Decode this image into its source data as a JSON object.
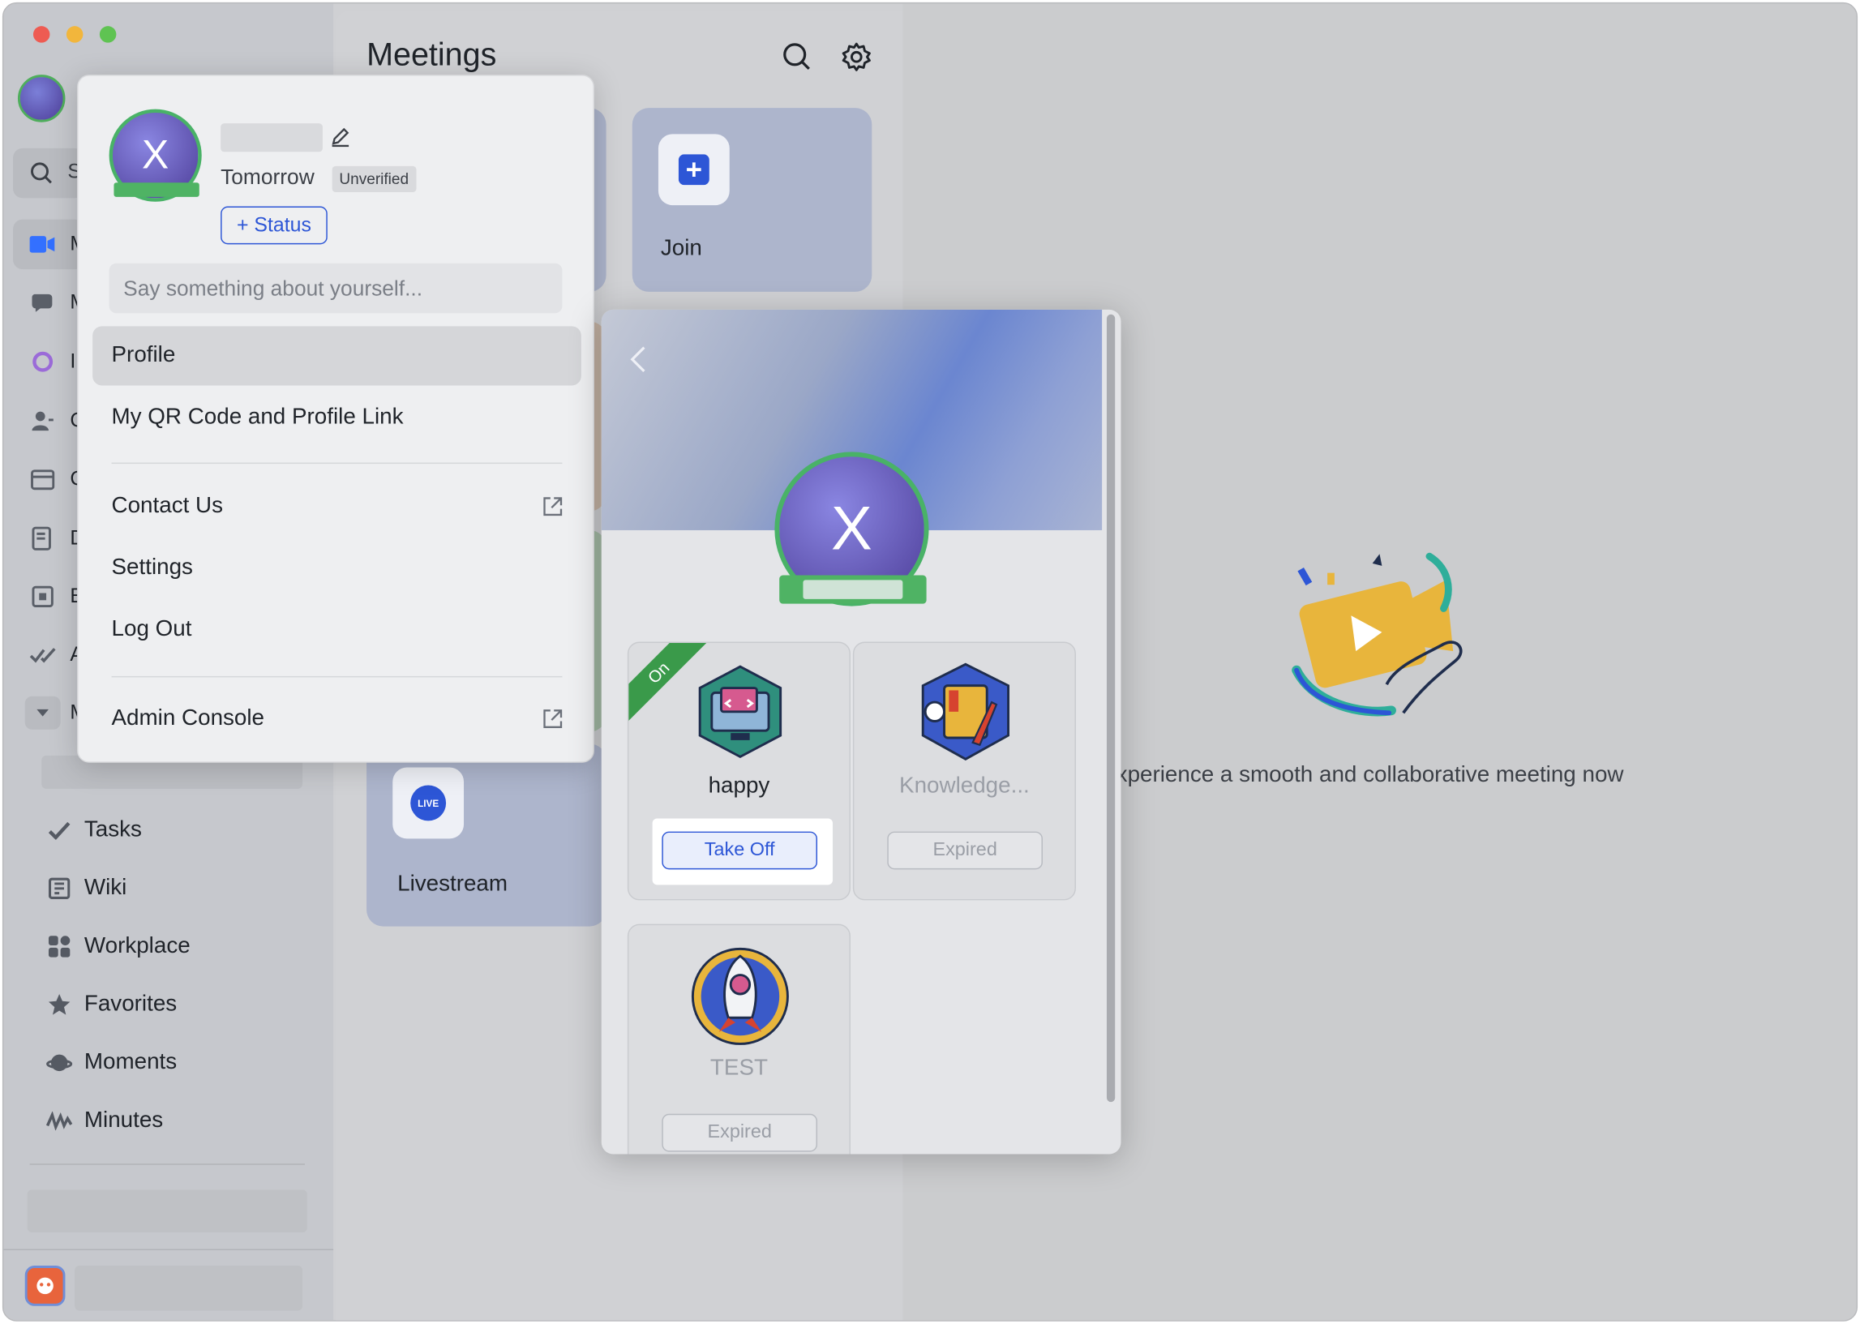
{
  "window": {
    "traffic_colors": [
      "#ee5b52",
      "#f2b63c",
      "#5fc352"
    ]
  },
  "sidebar": {
    "truncated_letters": [
      "S",
      "M",
      "M",
      "I",
      "C",
      "C",
      "D",
      "E",
      "A",
      "M"
    ],
    "nav_items": [
      {
        "label": "Tasks",
        "icon": "check-icon"
      },
      {
        "label": "Wiki",
        "icon": "wiki-icon"
      },
      {
        "label": "Workplace",
        "icon": "grid-icon"
      },
      {
        "label": "Favorites",
        "icon": "star-icon"
      },
      {
        "label": "Moments",
        "icon": "planet-icon"
      },
      {
        "label": "Minutes",
        "icon": "waveform-icon"
      }
    ]
  },
  "meetings": {
    "title": "Meetings",
    "join_label": "Join",
    "livestream_label": "Livestream",
    "live_badge": "LIVE"
  },
  "empty_state": {
    "text": "xperience a smooth and collaborative meeting now"
  },
  "profile_menu": {
    "avatar_letter": "X",
    "status_word": "Tomorrow",
    "unverified_badge": "Unverified",
    "status_button": "+ Status",
    "about_placeholder": "Say something about yourself...",
    "items": {
      "profile": "Profile",
      "qr": "My QR Code and Profile Link",
      "contact": "Contact Us",
      "settings": "Settings",
      "logout": "Log Out",
      "admin": "Admin Console"
    }
  },
  "badge_panel": {
    "avatar_letter": "X",
    "badges": [
      {
        "name": "happy",
        "button": "Take Off",
        "ribbon": "On"
      },
      {
        "name": "Knowledge...",
        "button": "Expired"
      },
      {
        "name": "TEST",
        "button": "Expired"
      }
    ]
  }
}
